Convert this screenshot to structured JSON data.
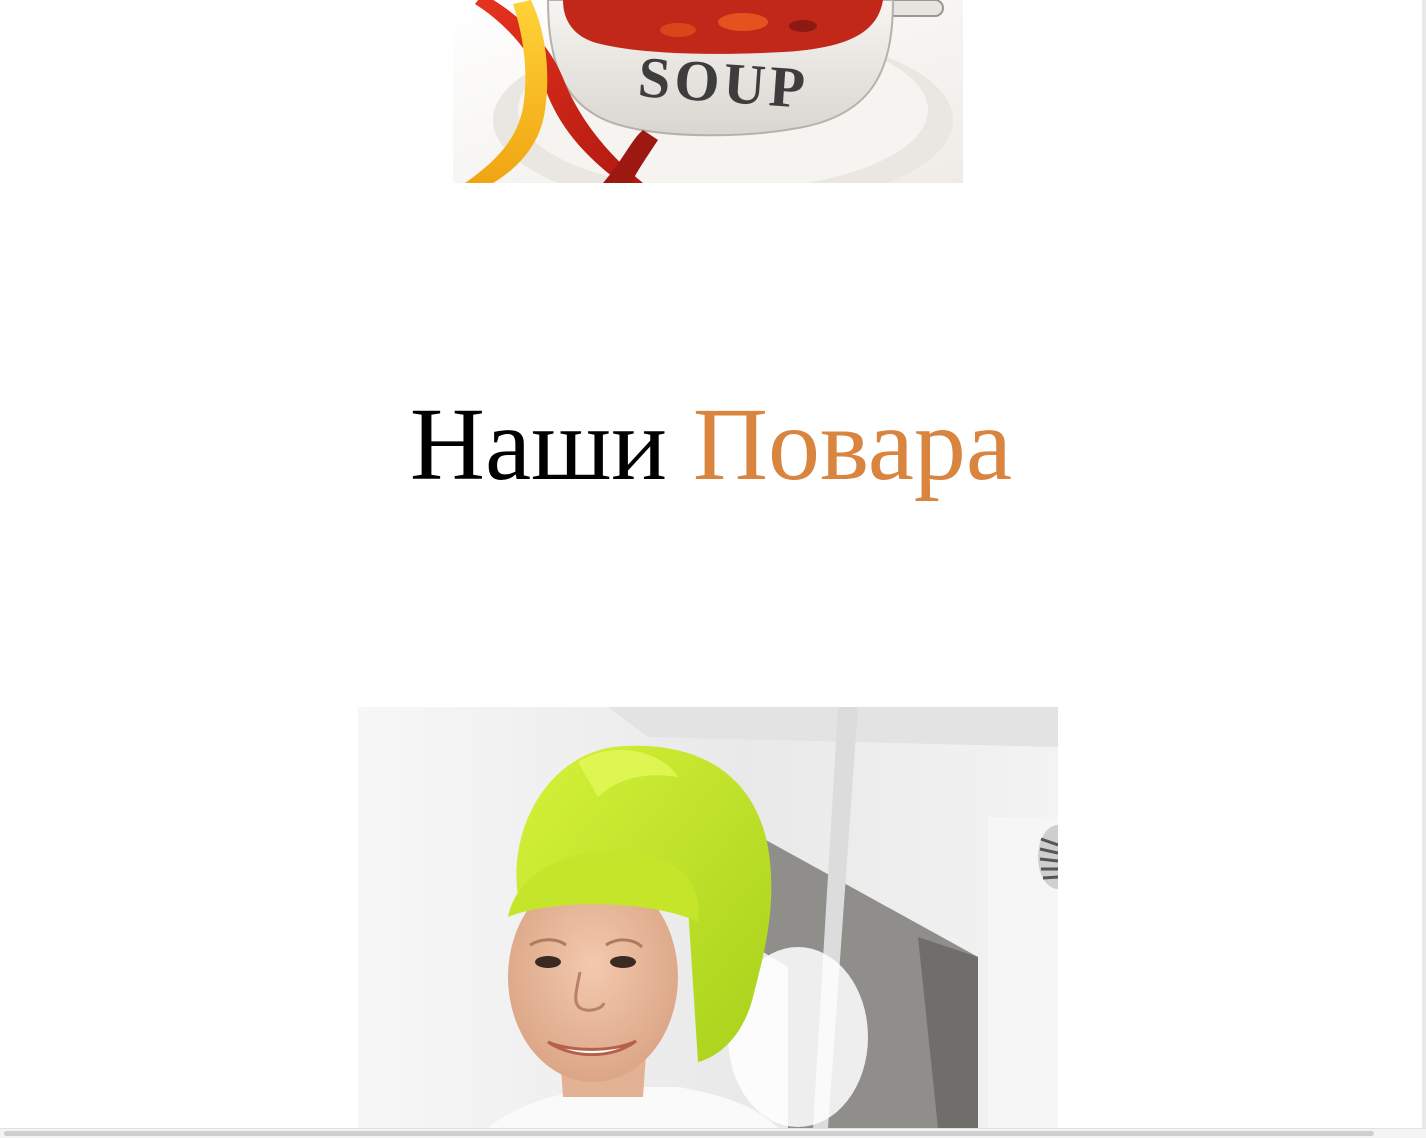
{
  "images": {
    "soup": {
      "description_icon": "soup-bowl-image",
      "bowl_text": "SOUP"
    },
    "chef": {
      "description_icon": "chef-portrait-image"
    }
  },
  "section": {
    "title_part1": "Наши",
    "title_part2": "Повара"
  },
  "colors": {
    "accent": "#d9843f",
    "text": "#000000",
    "background": "#ffffff"
  }
}
